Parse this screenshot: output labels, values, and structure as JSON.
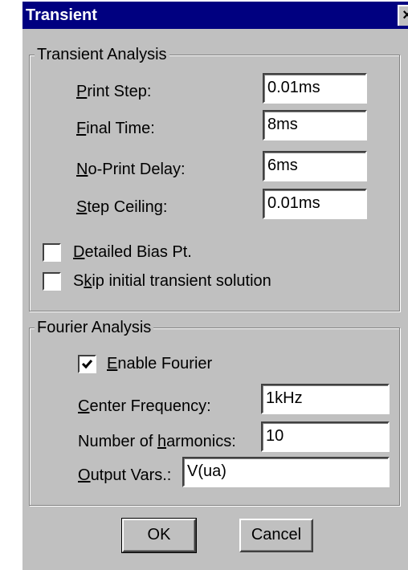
{
  "window": {
    "title": "Transient",
    "close_glyph": "×"
  },
  "transient": {
    "legend": "Transient Analysis",
    "print_step": {
      "label_u": "P",
      "label_rest": "rint Step:",
      "value": "0.01ms"
    },
    "final_time": {
      "label_u": "F",
      "label_rest": "inal Time:",
      "value": "8ms"
    },
    "no_print_delay": {
      "label_u": "N",
      "label_rest": "o-Print Delay:",
      "value": "6ms"
    },
    "step_ceiling": {
      "label_u": "S",
      "label_rest": "tep Ceiling:",
      "value": "0.01ms"
    },
    "detailed_bias": {
      "label_u": "D",
      "label_rest": "etailed Bias Pt.",
      "checked": false
    },
    "skip_initial": {
      "label_pre": "S",
      "label_u": "k",
      "label_rest": "ip initial transient solution",
      "checked": false
    }
  },
  "fourier": {
    "legend": "Fourier Analysis",
    "enable": {
      "label_u": "E",
      "label_rest": "nable Fourier",
      "checked": true
    },
    "center_freq": {
      "label_u": "C",
      "label_rest": "enter Frequency:",
      "value": "1kHz"
    },
    "harmonics": {
      "label_pre": "Number of ",
      "label_u": "h",
      "label_rest": "armonics:",
      "value": "10"
    },
    "output_vars": {
      "label_u": "O",
      "label_rest": "utput Vars.:",
      "value": "V(ua)"
    }
  },
  "buttons": {
    "ok": "OK",
    "cancel": "Cancel"
  }
}
